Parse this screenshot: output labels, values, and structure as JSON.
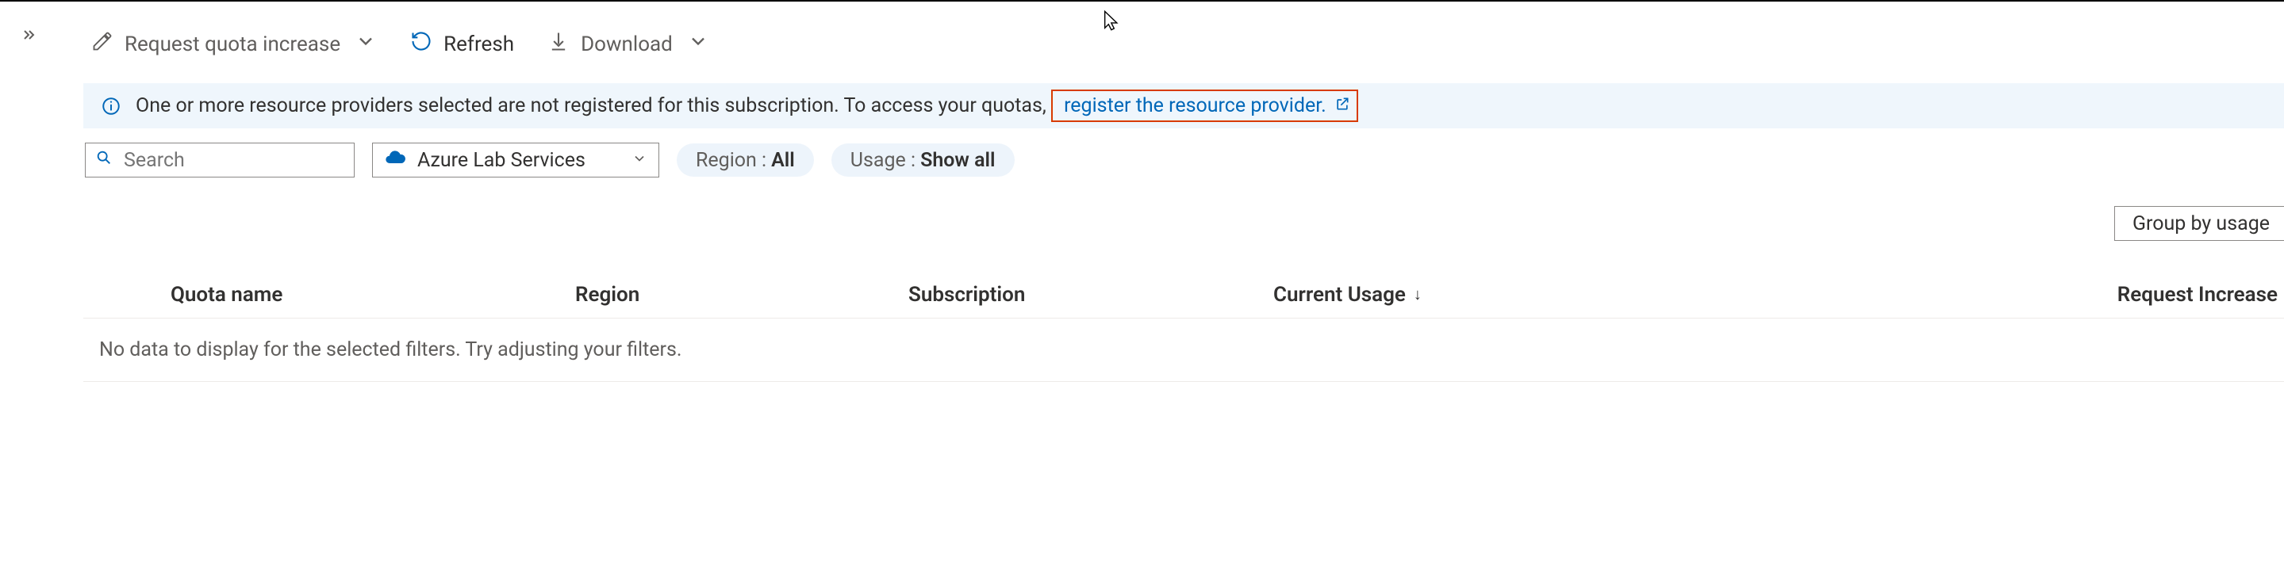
{
  "toolbar": {
    "request_increase_label": "Request quota increase",
    "refresh_label": "Refresh",
    "download_label": "Download"
  },
  "banner": {
    "message": "One or more resource providers selected are not registered for this subscription. To access your quotas,",
    "link_text": "register the resource provider."
  },
  "filters": {
    "search_placeholder": "Search",
    "provider_selected": "Azure Lab Services",
    "region_label": "Region :",
    "region_value": "All",
    "usage_label": "Usage :",
    "usage_value": "Show all"
  },
  "groupby": {
    "label": "Group by usage"
  },
  "table": {
    "columns": {
      "quota": "Quota name",
      "region": "Region",
      "subscription": "Subscription",
      "usage": "Current Usage",
      "request": "Request Increase"
    },
    "empty_message": "No data to display for the selected filters. Try adjusting your filters."
  }
}
